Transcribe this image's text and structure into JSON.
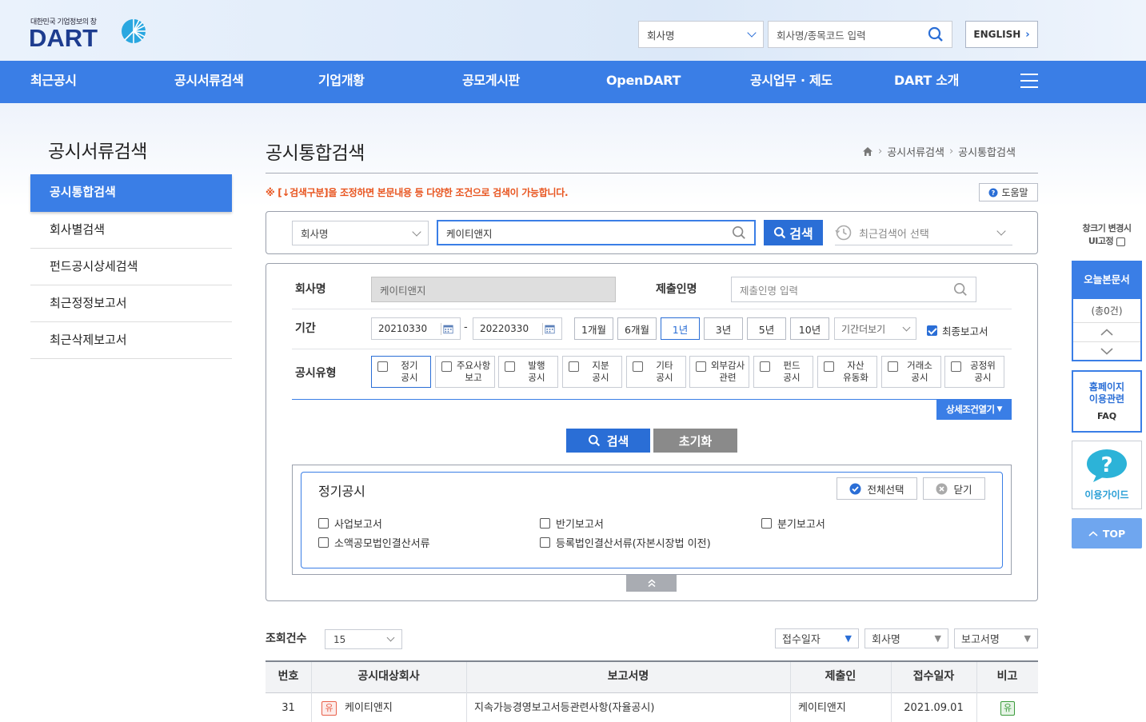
{
  "header": {
    "logo_tagline": "대한민국 기업정보의 창",
    "logo_text": "DART",
    "search_type": "회사명",
    "search_placeholder": "회사명/종목코드 입력",
    "english_label": "ENGLISH"
  },
  "nav": [
    "최근공시",
    "공시서류검색",
    "기업개황",
    "공모게시판",
    "OpenDART",
    "공시업무 · 제도",
    "DART 소개"
  ],
  "sidebar": {
    "title": "공시서류검색",
    "items": [
      "공시통합검색",
      "회사별검색",
      "펀드공시상세검색",
      "최근정정보고서",
      "최근삭제보고서"
    ]
  },
  "main": {
    "title": "공시통합검색",
    "breadcrumb": [
      "공시서류검색",
      "공시통합검색"
    ],
    "notice": "※ [↓검색구분]을 조정하면 본문내용 등 다양한 조건으로 검색이 가능합니다.",
    "help_label": "도움말",
    "quick": {
      "type": "회사명",
      "value": "케이티앤지",
      "search_label": "검색",
      "recent_placeholder": "최근검색어 선택"
    },
    "form": {
      "company_label": "회사명",
      "company_value": "케이티앤지",
      "submitter_label": "제출인명",
      "submitter_placeholder": "제출인명 입력",
      "period_label": "기간",
      "date_from": "20210330",
      "date_sep": "-",
      "date_to": "20220330",
      "periods": [
        "1개월",
        "6개월",
        "1년",
        "3년",
        "5년",
        "10년"
      ],
      "period_active": "1년",
      "period_more": "기간더보기",
      "final_report_label": "최종보고서",
      "final_report_checked": true,
      "type_label": "공시유형",
      "types": [
        {
          "l1": "정기",
          "l2": "공시"
        },
        {
          "l1": "주요사항",
          "l2": "보고"
        },
        {
          "l1": "발행",
          "l2": "공시"
        },
        {
          "l1": "지분",
          "l2": "공시"
        },
        {
          "l1": "기타",
          "l2": "공시"
        },
        {
          "l1": "외부감사",
          "l2": "관련"
        },
        {
          "l1": "펀드",
          "l2": "공시"
        },
        {
          "l1": "자산",
          "l2": "유동화"
        },
        {
          "l1": "거래소",
          "l2": "공시"
        },
        {
          "l1": "공정위",
          "l2": "공시"
        }
      ],
      "detail_toggle": "상세조건열기",
      "search_label": "검색",
      "reset_label": "초기화"
    },
    "panel": {
      "title": "정기공시",
      "select_all": "전체선택",
      "close": "닫기",
      "options": [
        "사업보고서",
        "반기보고서",
        "분기보고서",
        "소액공모법인결산서류",
        "등록법인결산서류(자본시장법 이전)"
      ]
    },
    "results": {
      "count_label": "조회건수",
      "count_value": "15",
      "sort": [
        "접수일자",
        "회사명",
        "보고서명"
      ],
      "columns": [
        "번호",
        "공시대상회사",
        "보고서명",
        "제출인",
        "접수일자",
        "비고"
      ],
      "rows": [
        {
          "no": "31",
          "badge": "유",
          "company": "케이티앤지",
          "report": "지속가능경영보고서등관련사항(자율공시)",
          "submitter": "케이티앤지",
          "date": "2021.09.01",
          "note": "유"
        }
      ]
    }
  },
  "right": {
    "resize_note_1": "창크기 변경시",
    "resize_note_2": "UI고정",
    "today_label": "오늘본문서",
    "today_count": "(총0건)",
    "homepage_1": "홈페이지",
    "homepage_2": "이용관련",
    "faq": "FAQ",
    "guide": "이용가이드",
    "top": "TOP"
  },
  "colors": {
    "primary": "#3a7ee6",
    "button": "#2a6ed6",
    "notice": "#e8541e",
    "badge_red": "#e8604a",
    "badge_green": "#3a9a3a"
  }
}
